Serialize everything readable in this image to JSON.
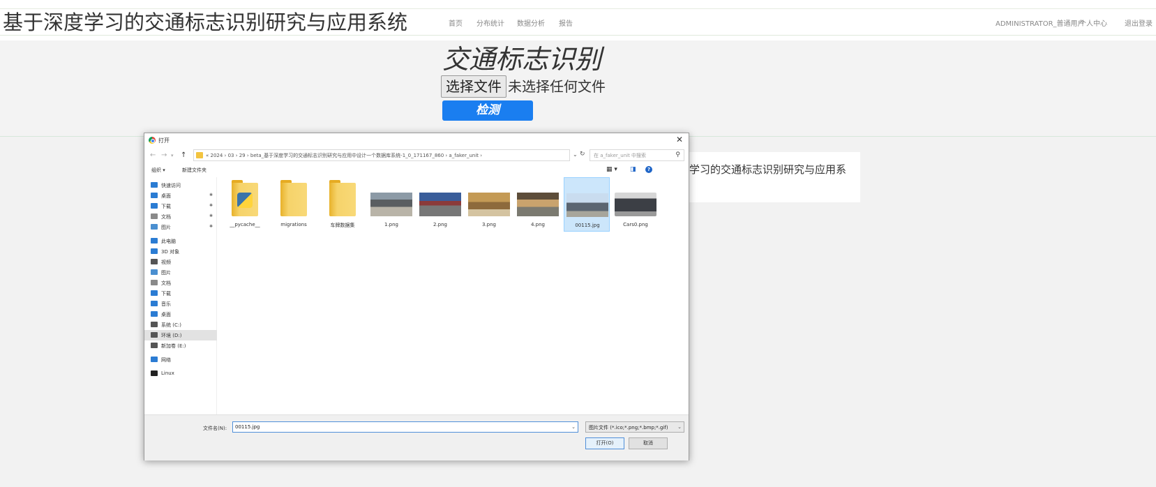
{
  "site": {
    "title": "基于深度学习的交通标志识别研究与应用系统",
    "nav": [
      "首页",
      "分布统计",
      "数据分析",
      "报告"
    ],
    "user": "ADMINISTRATOR_普通用户",
    "personal_center": "个人中心",
    "logout": "退出登录"
  },
  "hero": {
    "title": "交通标志识别",
    "choose_file": "选择文件",
    "no_file": "未选择任何文件",
    "detect": "检测"
  },
  "background_card": {
    "text": "基于深度学习的交通标志识别研究与应用系"
  },
  "dialog": {
    "title": "打开",
    "path": "« 2024 › 03 › 29 › beta_基于深度学习的交通标志识别研究与应用中设计一个数据库系统-1_0_171167_860 › a_faker_unit ›",
    "search_placeholder": "在 a_faker_unit 中搜索",
    "organize": "组织 ▾",
    "new_folder": "新建文件夹",
    "nav_pane": [
      {
        "label": "快速访问",
        "icon": "star-icon",
        "color": "#2b7cd3"
      },
      {
        "label": "桌面",
        "icon": "desktop-icon",
        "color": "#2b7cd3",
        "pinned": true
      },
      {
        "label": "下载",
        "icon": "download-icon",
        "color": "#2b7cd3",
        "pinned": true
      },
      {
        "label": "文档",
        "icon": "document-icon",
        "color": "#8a8a8a",
        "pinned": true
      },
      {
        "label": "图片",
        "icon": "picture-icon",
        "color": "#4a8fd0",
        "pinned": true
      },
      {
        "label": "此电脑",
        "icon": "computer-icon",
        "color": "#2b7cd3"
      },
      {
        "label": "3D 对象",
        "icon": "cube-icon",
        "color": "#2b7cd3"
      },
      {
        "label": "视频",
        "icon": "video-icon",
        "color": "#555555"
      },
      {
        "label": "图片",
        "icon": "picture-icon",
        "color": "#4a8fd0"
      },
      {
        "label": "文档",
        "icon": "document-icon",
        "color": "#8a8a8a"
      },
      {
        "label": "下载",
        "icon": "download-icon",
        "color": "#2b7cd3"
      },
      {
        "label": "音乐",
        "icon": "music-icon",
        "color": "#2b7cd3"
      },
      {
        "label": "桌面",
        "icon": "desktop-icon",
        "color": "#2b7cd3"
      },
      {
        "label": "系统 (C:)",
        "icon": "drive-icon",
        "color": "#555555"
      },
      {
        "label": "环境 (D:)",
        "icon": "drive-icon",
        "color": "#555555",
        "selected": true
      },
      {
        "label": "新加卷 (E:)",
        "icon": "drive-icon",
        "color": "#555555"
      },
      {
        "label": "网络",
        "icon": "network-icon",
        "color": "#2b7cd3"
      },
      {
        "label": "Linux",
        "icon": "linux-icon",
        "color": "#222222"
      }
    ],
    "files": [
      {
        "name": "__pycache__",
        "kind": "py-folder"
      },
      {
        "name": "migrations",
        "kind": "folder"
      },
      {
        "name": "车牌数据集",
        "kind": "folder"
      },
      {
        "name": "1.png",
        "kind": "photo",
        "variant": "p1"
      },
      {
        "name": "2.png",
        "kind": "photo",
        "variant": "p2"
      },
      {
        "name": "3.png",
        "kind": "photo",
        "variant": "p3"
      },
      {
        "name": "4.png",
        "kind": "photo",
        "variant": "p4"
      },
      {
        "name": "00115.jpg",
        "kind": "photo",
        "variant": "p5",
        "selected": true
      },
      {
        "name": "Cars0.png",
        "kind": "photo",
        "variant": "p6"
      }
    ],
    "filename_label": "文件名(N):",
    "filename_value": "00115.jpg",
    "filetype": "图片文件 (*.ico;*.png;*.bmp;*.gif)",
    "open": "打开(O)",
    "cancel": "取消"
  },
  "colors": {
    "accent": "#1a7ef0",
    "selection": "#cce6fb"
  }
}
